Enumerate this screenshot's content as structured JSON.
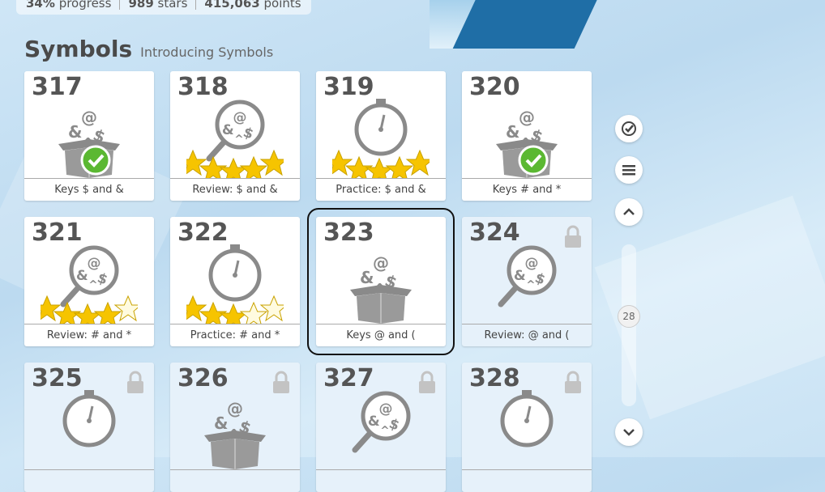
{
  "stats": {
    "progress": "34%",
    "progress_label": "progress",
    "stars": "989",
    "stars_label": "stars",
    "points": "415,063",
    "points_label": "points"
  },
  "section": {
    "title": "Symbols",
    "subtitle": "Introducing Symbols"
  },
  "tiles": [
    {
      "num": "317",
      "caption": "Keys $ and &",
      "icon": "box-icon",
      "status": "complete",
      "stars": 0
    },
    {
      "num": "318",
      "caption": "Review: $ and &",
      "icon": "magnifier-icon",
      "status": "done",
      "stars": 5
    },
    {
      "num": "319",
      "caption": "Practice: $ and &",
      "icon": "stopwatch-icon",
      "status": "done",
      "stars": 5
    },
    {
      "num": "320",
      "caption": "Keys # and *",
      "icon": "box-icon",
      "status": "complete",
      "stars": 0
    },
    {
      "num": "321",
      "caption": "Review: # and *",
      "icon": "magnifier-icon",
      "status": "done",
      "stars": 4
    },
    {
      "num": "322",
      "caption": "Practice: # and *",
      "icon": "stopwatch-icon",
      "status": "done",
      "stars": 3
    },
    {
      "num": "323",
      "caption": "Keys @ and (",
      "icon": "box-icon",
      "status": "current",
      "stars": 0
    },
    {
      "num": "324",
      "caption": "Review: @ and (",
      "icon": "magnifier-icon",
      "status": "locked",
      "stars": 0
    },
    {
      "num": "325",
      "caption": "",
      "icon": "stopwatch-icon",
      "status": "locked",
      "stars": 0
    },
    {
      "num": "326",
      "caption": "",
      "icon": "box-icon",
      "status": "locked",
      "stars": 0
    },
    {
      "num": "327",
      "caption": "",
      "icon": "magnifier-icon",
      "status": "locked",
      "stars": 0
    },
    {
      "num": "328",
      "caption": "",
      "icon": "stopwatch-icon",
      "status": "locked",
      "stars": 0
    }
  ],
  "side": {
    "scroll_value": "28"
  },
  "colors": {
    "accent": "#1f6ea6",
    "star": "#f6c400",
    "check": "#5bb832",
    "icon_gray": "#888888"
  }
}
